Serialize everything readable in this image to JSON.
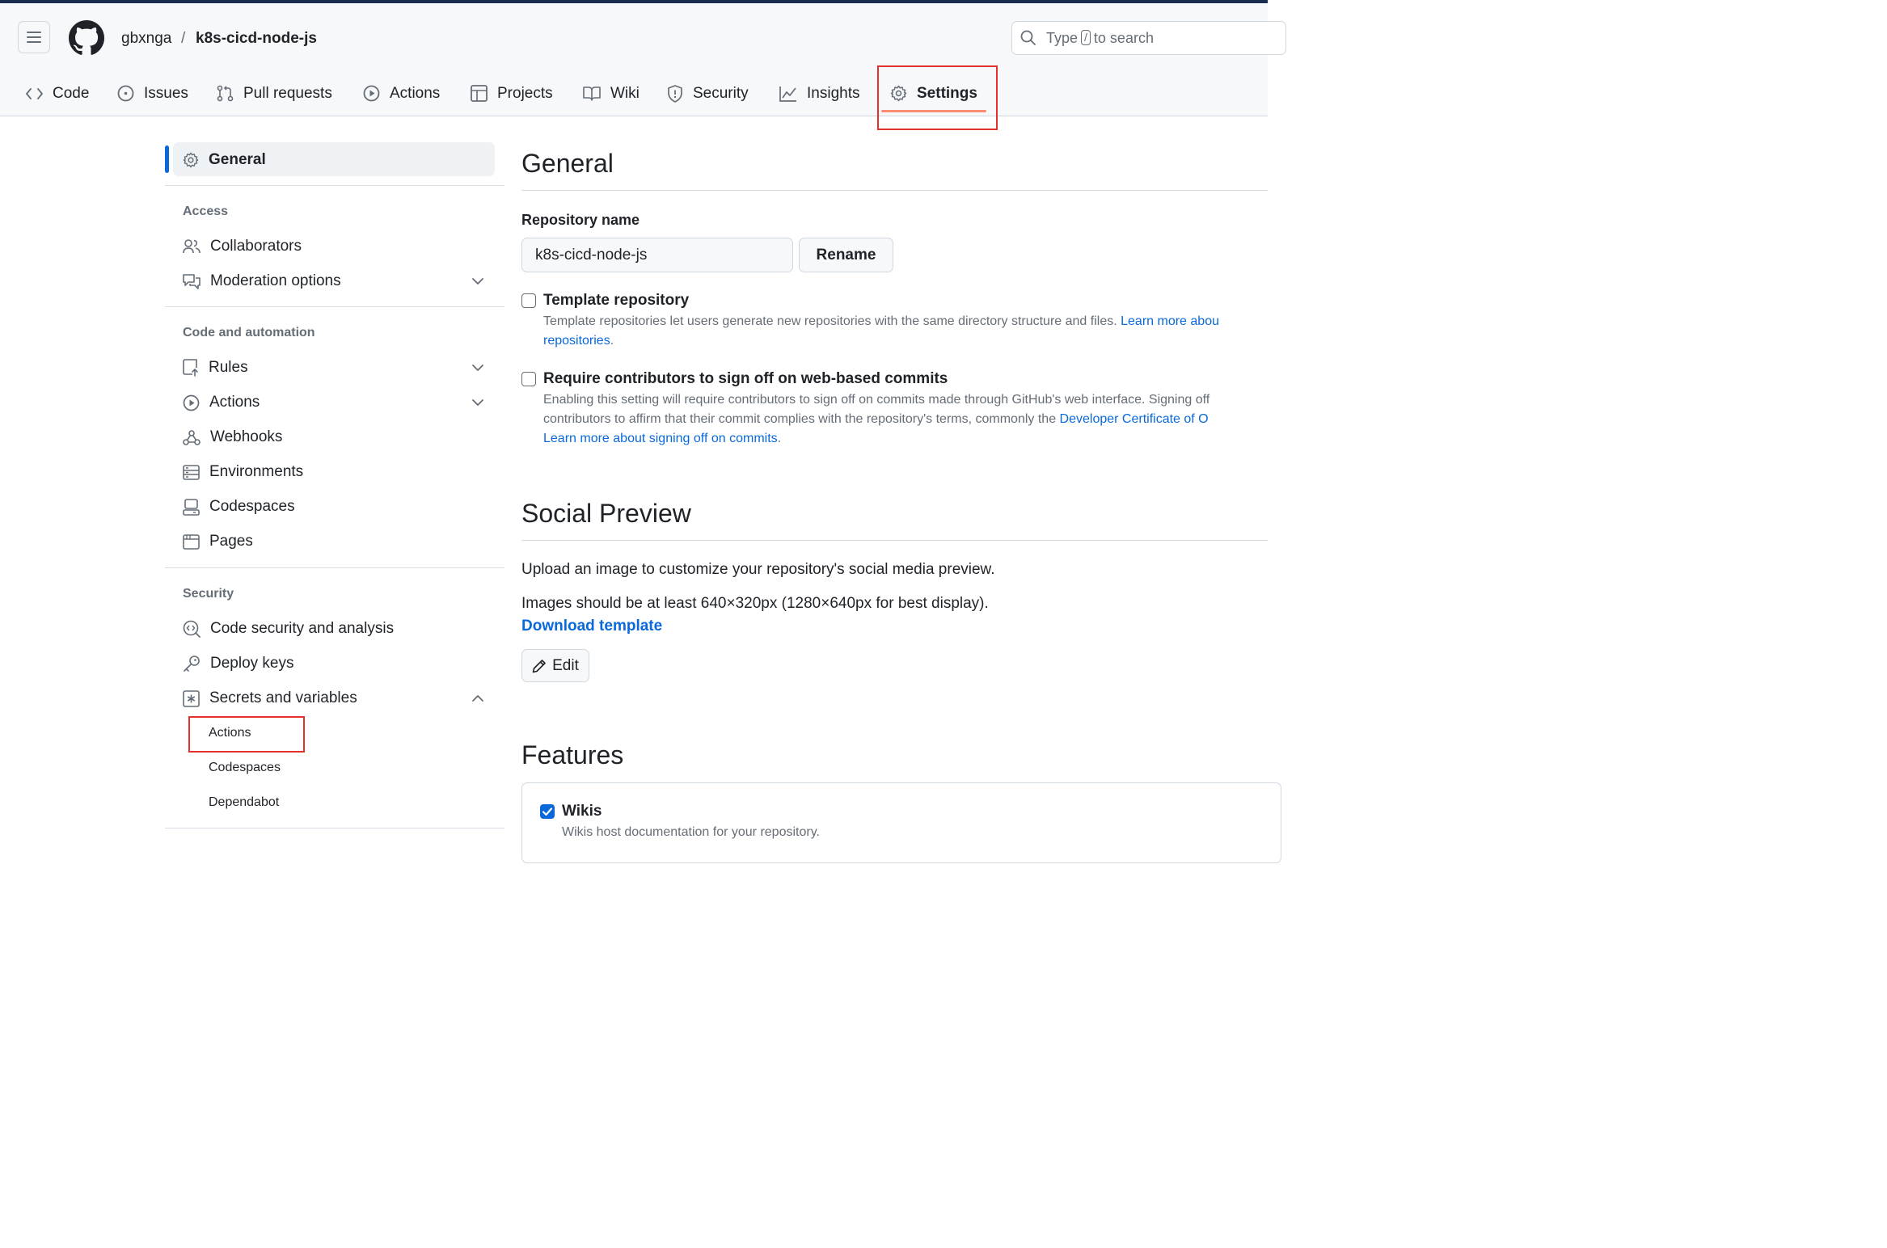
{
  "header": {
    "owner": "gbxnga",
    "separator": "/",
    "repo": "k8s-cicd-node-js",
    "search_pre": "Type",
    "search_key": "/",
    "search_post": "to search"
  },
  "tabs": [
    {
      "label": "Code",
      "icon": "code-icon"
    },
    {
      "label": "Issues",
      "icon": "issue-icon"
    },
    {
      "label": "Pull requests",
      "icon": "pull-request-icon"
    },
    {
      "label": "Actions",
      "icon": "play-icon"
    },
    {
      "label": "Projects",
      "icon": "table-icon"
    },
    {
      "label": "Wiki",
      "icon": "book-icon"
    },
    {
      "label": "Security",
      "icon": "shield-icon"
    },
    {
      "label": "Insights",
      "icon": "graph-icon"
    },
    {
      "label": "Settings",
      "icon": "gear-icon",
      "active": true
    }
  ],
  "sidebar": {
    "general": "General",
    "access_heading": "Access",
    "collaborators": "Collaborators",
    "moderation": "Moderation options",
    "code_heading": "Code and automation",
    "rules": "Rules",
    "actions": "Actions",
    "webhooks": "Webhooks",
    "environments": "Environments",
    "codespaces": "Codespaces",
    "pages": "Pages",
    "security_heading": "Security",
    "code_security": "Code security and analysis",
    "deploy_keys": "Deploy keys",
    "secrets": "Secrets and variables",
    "sub_actions": "Actions",
    "sub_codespaces": "Codespaces",
    "sub_dependabot": "Dependabot"
  },
  "main": {
    "general_title": "General",
    "repo_name_label": "Repository name",
    "repo_name_value": "k8s-cicd-node-js",
    "rename_button": "Rename",
    "template_title": "Template repository",
    "template_desc": "Template repositories let users generate new repositories with the same directory structure and files.",
    "template_link1": "Learn more abou",
    "template_link2": "repositories",
    "template_period": ".",
    "signoff_title": "Require contributors to sign off on web-based commits",
    "signoff_desc1": "Enabling this setting will require contributors to sign off on commits made through GitHub's web interface. Signing off",
    "signoff_desc2": "contributors to affirm that their commit complies with the repository's terms, commonly the",
    "signoff_link_dco": "Developer Certificate of O",
    "signoff_link_learn": "Learn more about signing off on commits",
    "signoff_period": ".",
    "social_title": "Social Preview",
    "social_p1": "Upload an image to customize your repository's social media preview.",
    "social_p2": "Images should be at least 640×320px (1280×640px for best display).",
    "download_template": "Download template",
    "edit_button": "Edit",
    "features_title": "Features",
    "wikis_title": "Wikis",
    "wikis_desc": "Wikis host documentation for your repository."
  },
  "colors": {
    "accent": "#0969da",
    "highlight": "#e5302b",
    "tab_underline": "#fd8c73"
  }
}
